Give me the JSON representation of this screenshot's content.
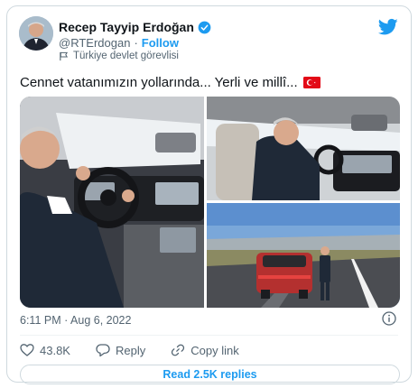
{
  "tweet": {
    "author": {
      "display_name": "Recep Tayyip Erdoğan",
      "handle": "@RTErdogan",
      "label": "Türkiye devlet görevlisi",
      "avatar_icon": "avatar-photo",
      "verified_icon": "verified-badge-icon"
    },
    "follow_label": "Follow",
    "separator": "·",
    "text": "Cennet vatanımızın yollarında... Yerli ve millî...",
    "text_flag_icon": "turkey-flag-icon",
    "timestamp": "6:11 PM · Aug 6, 2022",
    "actions": {
      "like_count": "43.8K",
      "reply_label": "Reply",
      "copy_link_label": "Copy link"
    },
    "read_replies_label": "Read 2.5K replies"
  },
  "brand_icon": "twitter-bird-icon",
  "colors": {
    "accent": "#1d9bf0",
    "text": "#0f1419",
    "muted": "#536471",
    "border": "#cfd9de"
  }
}
